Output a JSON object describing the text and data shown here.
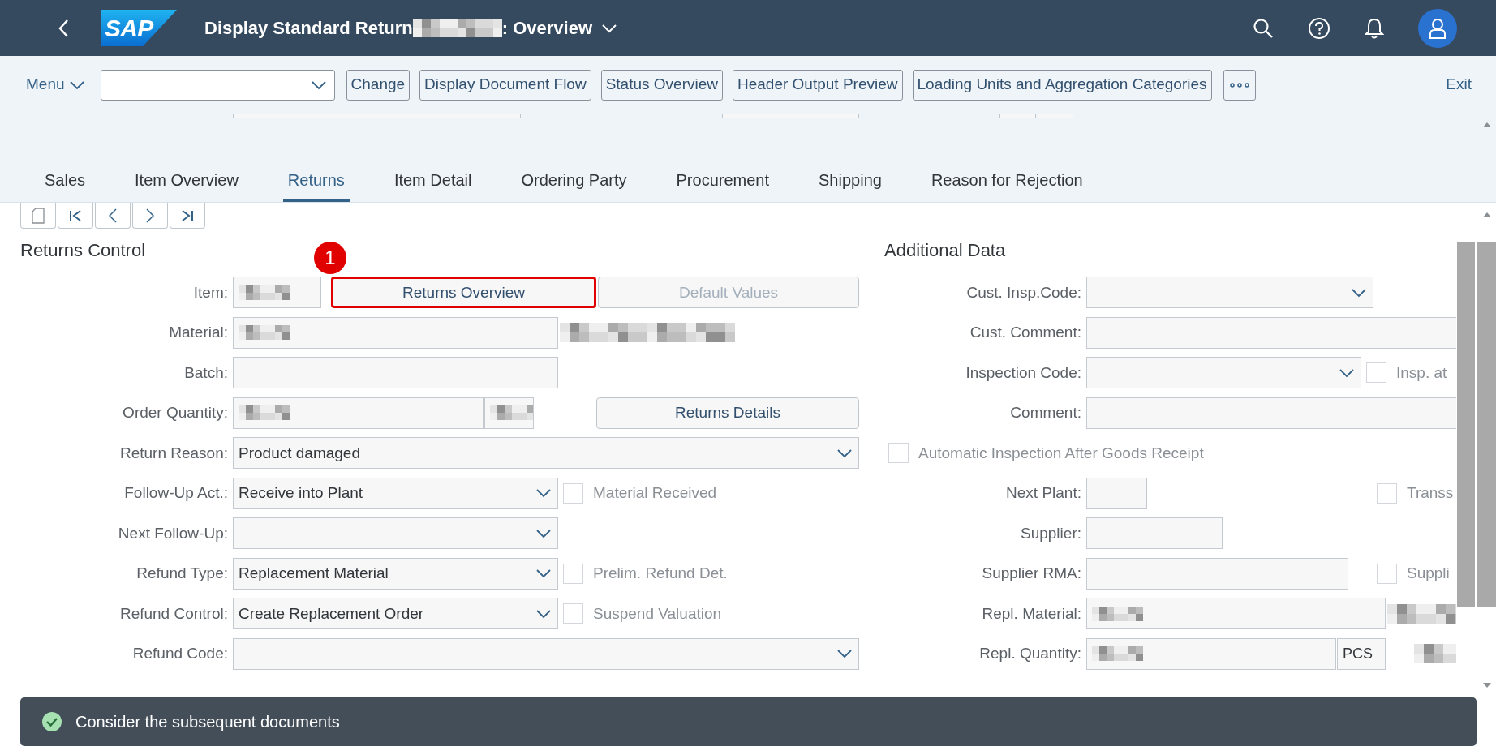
{
  "header": {
    "logo": "SAP",
    "title": "Display Standard Return",
    "title_redacted": true,
    "title_suffix": ": Overview"
  },
  "toolbar": {
    "menu": "Menu",
    "buttons": [
      "Change",
      "Display Document Flow",
      "Status Overview",
      "Header Output Preview",
      "Loading Units and Aggregation Categories"
    ],
    "exit": "Exit"
  },
  "tabs": [
    {
      "label": "Sales",
      "selected": false
    },
    {
      "label": "Item Overview",
      "selected": false
    },
    {
      "label": "Returns",
      "selected": true
    },
    {
      "label": "Item Detail",
      "selected": false
    },
    {
      "label": "Ordering Party",
      "selected": false
    },
    {
      "label": "Procurement",
      "selected": false
    },
    {
      "label": "Shipping",
      "selected": false
    },
    {
      "label": "Reason for Rejection",
      "selected": false
    }
  ],
  "returns_control": {
    "title": "Returns Control",
    "rows": [
      {
        "label": "Item:",
        "fields": [
          {
            "kind": "input",
            "redacted": true
          },
          {
            "kind": "button",
            "label": "Returns Overview",
            "highlighted": true,
            "badge": "1",
            "disabled": false
          },
          {
            "kind": "button",
            "label": "Default Values",
            "highlighted": false,
            "disabled": true
          }
        ]
      },
      {
        "label": "Material:",
        "fields": [
          {
            "kind": "input",
            "redacted": true
          },
          {
            "kind": "blurred"
          }
        ]
      },
      {
        "label": "Batch:",
        "fields": [
          {
            "kind": "input"
          }
        ]
      },
      {
        "label": "Order Quantity:",
        "fields": [
          {
            "kind": "input",
            "redacted": true
          },
          {
            "kind": "input",
            "redacted": true
          },
          {
            "kind": "button",
            "label": "Returns Details",
            "highlighted": false,
            "disabled": false
          }
        ]
      },
      {
        "label": "Return Reason:",
        "fields": [
          {
            "kind": "dropdown",
            "value": "Product damaged"
          }
        ]
      },
      {
        "label": "Follow-Up Act.:",
        "fields": [
          {
            "kind": "dropdown",
            "value": "Receive into Plant"
          },
          {
            "kind": "checkbox",
            "label": "Material Received",
            "checked": false
          }
        ]
      },
      {
        "label": "Next Follow-Up:",
        "fields": [
          {
            "kind": "dropdown"
          }
        ]
      },
      {
        "label": "Refund Type:",
        "fields": [
          {
            "kind": "dropdown",
            "value": "Replacement Material"
          },
          {
            "kind": "checkbox",
            "label": "Prelim. Refund Det.",
            "checked": false
          }
        ]
      },
      {
        "label": "Refund Control:",
        "fields": [
          {
            "kind": "dropdown",
            "value": "Create Replacement Order"
          },
          {
            "kind": "checkbox",
            "label": "Suspend Valuation",
            "checked": false
          }
        ]
      },
      {
        "label": "Refund Code:",
        "fields": [
          {
            "kind": "dropdown"
          }
        ]
      }
    ]
  },
  "additional_data": {
    "title": "Additional Data",
    "rows": [
      {
        "label": "Cust. Insp.Code:",
        "fields": [
          {
            "kind": "dropdown"
          }
        ]
      },
      {
        "label": "Cust. Comment:",
        "fields": [
          {
            "kind": "input"
          }
        ]
      },
      {
        "label": "Inspection Code:",
        "fields": [
          {
            "kind": "dropdown"
          },
          {
            "kind": "checkbox",
            "label": "Insp. at",
            "checked": false
          }
        ]
      },
      {
        "label": "Comment:",
        "fields": [
          {
            "kind": "input"
          }
        ]
      },
      {
        "fields": [
          {
            "kind": "checkbox",
            "label": "Automatic Inspection After Goods Receipt",
            "checked": false
          }
        ]
      },
      {
        "label": "Next Plant:",
        "fields": [
          {
            "kind": "input"
          },
          {
            "kind": "checkbox",
            "label": "Transs",
            "checked": false
          }
        ]
      },
      {
        "label": "Supplier:",
        "fields": [
          {
            "kind": "input"
          }
        ]
      },
      {
        "label": "Supplier RMA:",
        "fields": [
          {
            "kind": "input"
          },
          {
            "kind": "checkbox",
            "label": "Suppli",
            "checked": false
          }
        ]
      },
      {
        "label": "Repl. Material:",
        "fields": [
          {
            "kind": "input",
            "redacted": true
          },
          {
            "kind": "blurred"
          }
        ]
      },
      {
        "label": "Repl. Quantity:",
        "fields": [
          {
            "kind": "input",
            "redacted": true
          },
          {
            "kind": "input",
            "value": "PCS"
          },
          {
            "kind": "blurred"
          }
        ]
      }
    ]
  },
  "message": {
    "text": "Consider the subsequent documents"
  }
}
